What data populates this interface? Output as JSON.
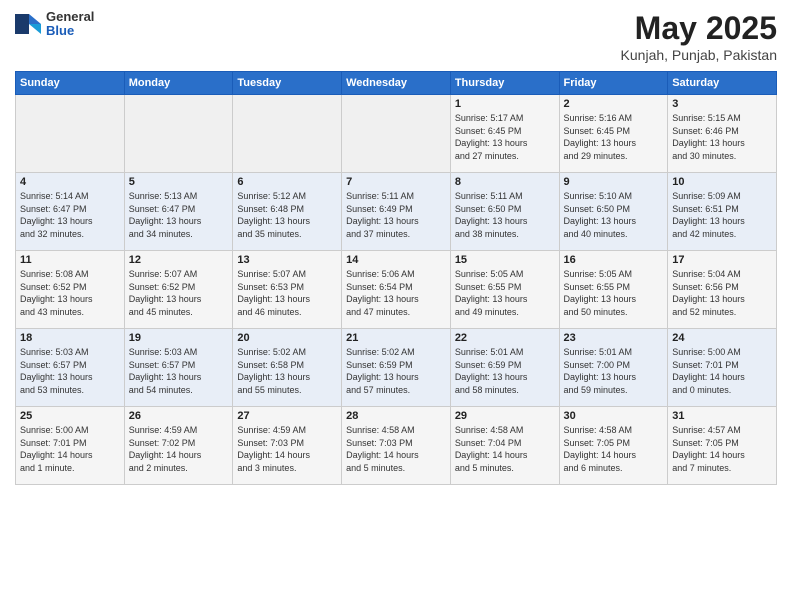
{
  "logo": {
    "general": "General",
    "blue": "Blue"
  },
  "title": "May 2025",
  "location": "Kunjah, Punjab, Pakistan",
  "days_of_week": [
    "Sunday",
    "Monday",
    "Tuesday",
    "Wednesday",
    "Thursday",
    "Friday",
    "Saturday"
  ],
  "weeks": [
    [
      {
        "day": "",
        "info": ""
      },
      {
        "day": "",
        "info": ""
      },
      {
        "day": "",
        "info": ""
      },
      {
        "day": "",
        "info": ""
      },
      {
        "day": "1",
        "info": "Sunrise: 5:17 AM\nSunset: 6:45 PM\nDaylight: 13 hours\nand 27 minutes."
      },
      {
        "day": "2",
        "info": "Sunrise: 5:16 AM\nSunset: 6:45 PM\nDaylight: 13 hours\nand 29 minutes."
      },
      {
        "day": "3",
        "info": "Sunrise: 5:15 AM\nSunset: 6:46 PM\nDaylight: 13 hours\nand 30 minutes."
      }
    ],
    [
      {
        "day": "4",
        "info": "Sunrise: 5:14 AM\nSunset: 6:47 PM\nDaylight: 13 hours\nand 32 minutes."
      },
      {
        "day": "5",
        "info": "Sunrise: 5:13 AM\nSunset: 6:47 PM\nDaylight: 13 hours\nand 34 minutes."
      },
      {
        "day": "6",
        "info": "Sunrise: 5:12 AM\nSunset: 6:48 PM\nDaylight: 13 hours\nand 35 minutes."
      },
      {
        "day": "7",
        "info": "Sunrise: 5:11 AM\nSunset: 6:49 PM\nDaylight: 13 hours\nand 37 minutes."
      },
      {
        "day": "8",
        "info": "Sunrise: 5:11 AM\nSunset: 6:50 PM\nDaylight: 13 hours\nand 38 minutes."
      },
      {
        "day": "9",
        "info": "Sunrise: 5:10 AM\nSunset: 6:50 PM\nDaylight: 13 hours\nand 40 minutes."
      },
      {
        "day": "10",
        "info": "Sunrise: 5:09 AM\nSunset: 6:51 PM\nDaylight: 13 hours\nand 42 minutes."
      }
    ],
    [
      {
        "day": "11",
        "info": "Sunrise: 5:08 AM\nSunset: 6:52 PM\nDaylight: 13 hours\nand 43 minutes."
      },
      {
        "day": "12",
        "info": "Sunrise: 5:07 AM\nSunset: 6:52 PM\nDaylight: 13 hours\nand 45 minutes."
      },
      {
        "day": "13",
        "info": "Sunrise: 5:07 AM\nSunset: 6:53 PM\nDaylight: 13 hours\nand 46 minutes."
      },
      {
        "day": "14",
        "info": "Sunrise: 5:06 AM\nSunset: 6:54 PM\nDaylight: 13 hours\nand 47 minutes."
      },
      {
        "day": "15",
        "info": "Sunrise: 5:05 AM\nSunset: 6:55 PM\nDaylight: 13 hours\nand 49 minutes."
      },
      {
        "day": "16",
        "info": "Sunrise: 5:05 AM\nSunset: 6:55 PM\nDaylight: 13 hours\nand 50 minutes."
      },
      {
        "day": "17",
        "info": "Sunrise: 5:04 AM\nSunset: 6:56 PM\nDaylight: 13 hours\nand 52 minutes."
      }
    ],
    [
      {
        "day": "18",
        "info": "Sunrise: 5:03 AM\nSunset: 6:57 PM\nDaylight: 13 hours\nand 53 minutes."
      },
      {
        "day": "19",
        "info": "Sunrise: 5:03 AM\nSunset: 6:57 PM\nDaylight: 13 hours\nand 54 minutes."
      },
      {
        "day": "20",
        "info": "Sunrise: 5:02 AM\nSunset: 6:58 PM\nDaylight: 13 hours\nand 55 minutes."
      },
      {
        "day": "21",
        "info": "Sunrise: 5:02 AM\nSunset: 6:59 PM\nDaylight: 13 hours\nand 57 minutes."
      },
      {
        "day": "22",
        "info": "Sunrise: 5:01 AM\nSunset: 6:59 PM\nDaylight: 13 hours\nand 58 minutes."
      },
      {
        "day": "23",
        "info": "Sunrise: 5:01 AM\nSunset: 7:00 PM\nDaylight: 13 hours\nand 59 minutes."
      },
      {
        "day": "24",
        "info": "Sunrise: 5:00 AM\nSunset: 7:01 PM\nDaylight: 14 hours\nand 0 minutes."
      }
    ],
    [
      {
        "day": "25",
        "info": "Sunrise: 5:00 AM\nSunset: 7:01 PM\nDaylight: 14 hours\nand 1 minute."
      },
      {
        "day": "26",
        "info": "Sunrise: 4:59 AM\nSunset: 7:02 PM\nDaylight: 14 hours\nand 2 minutes."
      },
      {
        "day": "27",
        "info": "Sunrise: 4:59 AM\nSunset: 7:03 PM\nDaylight: 14 hours\nand 3 minutes."
      },
      {
        "day": "28",
        "info": "Sunrise: 4:58 AM\nSunset: 7:03 PM\nDaylight: 14 hours\nand 5 minutes."
      },
      {
        "day": "29",
        "info": "Sunrise: 4:58 AM\nSunset: 7:04 PM\nDaylight: 14 hours\nand 5 minutes."
      },
      {
        "day": "30",
        "info": "Sunrise: 4:58 AM\nSunset: 7:05 PM\nDaylight: 14 hours\nand 6 minutes."
      },
      {
        "day": "31",
        "info": "Sunrise: 4:57 AM\nSunset: 7:05 PM\nDaylight: 14 hours\nand 7 minutes."
      }
    ]
  ]
}
